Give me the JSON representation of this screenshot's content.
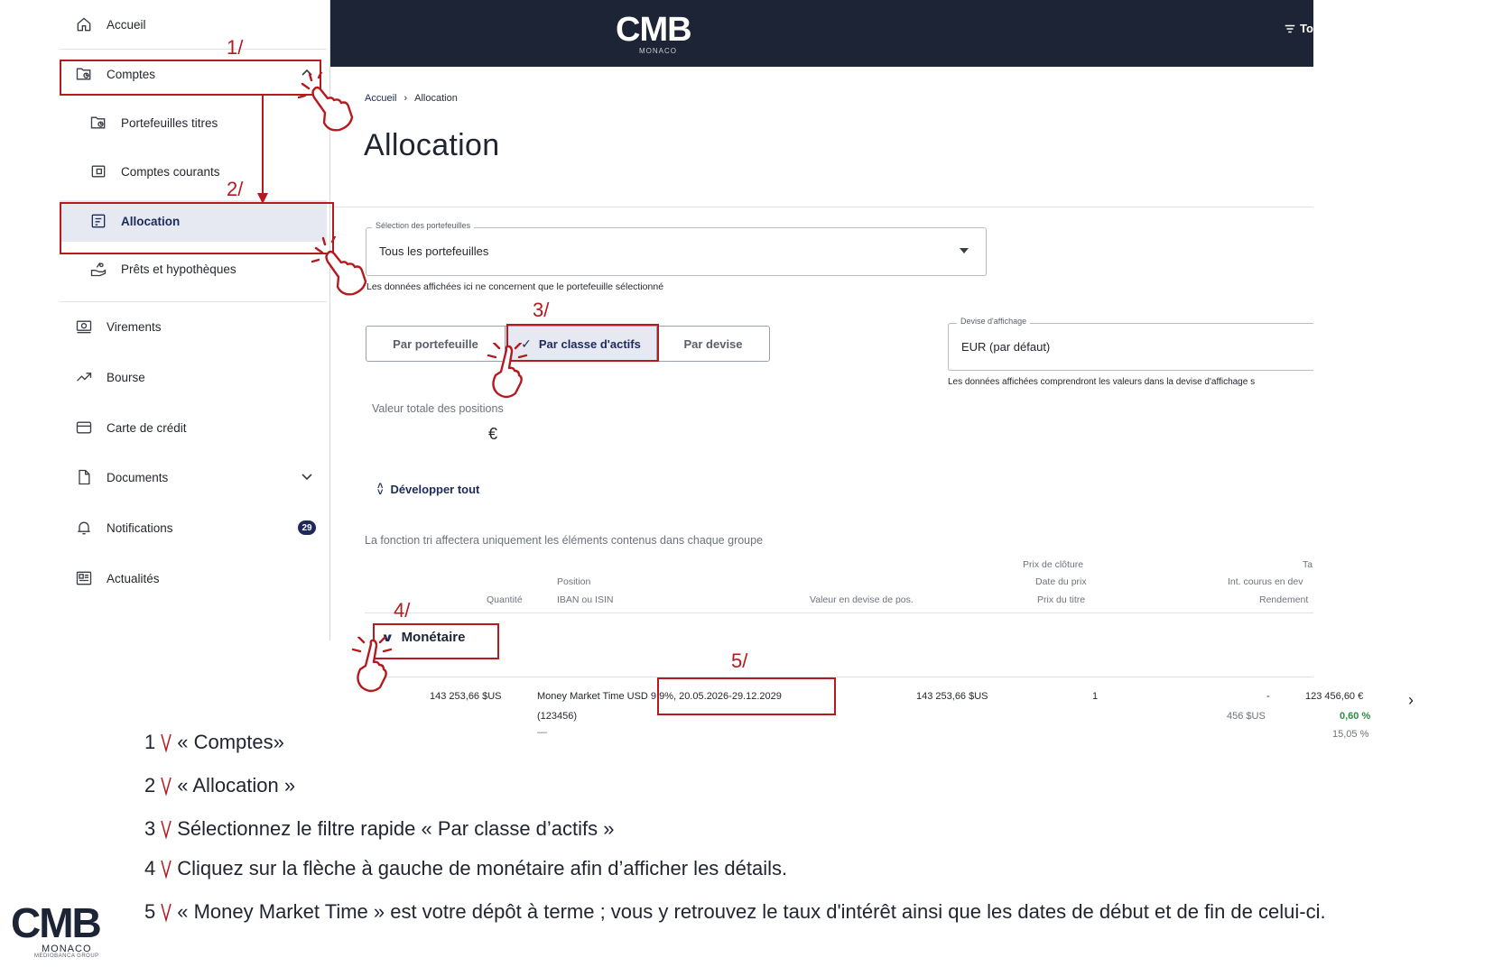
{
  "sidebar": {
    "items": [
      {
        "label": "Accueil",
        "icon": "home-icon"
      },
      {
        "label": "Comptes",
        "icon": "wallet-chart-icon"
      },
      {
        "label": "Portefeuilles titres",
        "icon": "portfolio-icon"
      },
      {
        "label": "Comptes courants",
        "icon": "wallet-icon"
      },
      {
        "label": "Allocation",
        "icon": "allocation-icon"
      },
      {
        "label": "Prêts et hypothèques",
        "icon": "loan-hand-icon"
      },
      {
        "label": "Virements",
        "icon": "transfer-icon"
      },
      {
        "label": "Bourse",
        "icon": "trend-up-icon"
      },
      {
        "label": "Carte de crédit",
        "icon": "credit-card-icon"
      },
      {
        "label": "Documents",
        "icon": "document-icon"
      },
      {
        "label": "Notifications",
        "icon": "bell-icon",
        "badge": "29"
      },
      {
        "label": "Actualités",
        "icon": "news-icon"
      }
    ]
  },
  "header": {
    "logo": "CMB",
    "logo_sub": "MONACO",
    "filter_label": "To"
  },
  "breadcrumb": {
    "home": "Accueil",
    "current": "Allocation"
  },
  "page": {
    "title": "Allocation"
  },
  "portfolio_select": {
    "legend": "Sélection des portefeuilles",
    "value": "Tous les portefeuilles",
    "help": "Les données affichées ici ne concernent que le portefeuille sélectionné"
  },
  "segmented": {
    "left": "Par portefeuille",
    "mid": "Par classe d'actifs",
    "right": "Par devise",
    "check": "✓"
  },
  "currency_select": {
    "legend": "Devise d'affichage",
    "value": "EUR (par défaut)",
    "help": "Les données affichées comprendront les valeurs dans la devise d'affichage s"
  },
  "total": {
    "label": "Valeur totale des positions",
    "value": "€"
  },
  "expand_all": "Développer tout",
  "sort_note": "La fonction tri affectera uniquement les éléments contenus dans chaque groupe",
  "table_headers": {
    "quantity": "Quantité",
    "position": "Position",
    "iban": "IBAN ou ISIN",
    "value_pos": "Valeur en devise de pos.",
    "close_price": "Prix de clôture",
    "price_date": "Date du prix",
    "title_price": "Prix du titre",
    "ta": "Ta",
    "accrued": "Int. courus en dev",
    "yield": "Rendement"
  },
  "group": {
    "label": "Monétaire"
  },
  "row": {
    "quantity": "143 253,66 $US",
    "position": "Money Market Time USD 9.9%, 20.05.2026-29.12.2029",
    "isin": "(123456)",
    "dash_small": "—",
    "value_pos": "143 253,66 $US",
    "close_price": "1",
    "dash": "-",
    "accrued": "456 $US",
    "amount": "123 456,60 €",
    "pct1": "0,60 %",
    "pct2": "15,05 %"
  },
  "annotations": {
    "n1": "1/",
    "n2": "2/",
    "n3": "3/",
    "n4": "4/",
    "n5": "5/",
    "color": "#b51a1f"
  },
  "instructions": [
    {
      "num": "1",
      "text": "« Comptes»"
    },
    {
      "num": "2",
      "text": "« Allocation »"
    },
    {
      "num": "3",
      "text": " Sélectionnez le filtre rapide « Par classe d’actifs »"
    },
    {
      "num": "4",
      "text": "Cliquez sur la flèche à gauche de monétaire afin d’afficher les détails."
    },
    {
      "num": "5",
      "text": "« Money Market Time » est votre dépôt à terme ; vous y retrouvez le taux d'intérêt ainsi que les dates de début et de fin de celui-ci."
    }
  ],
  "footer_logo": {
    "cmb": "CMB",
    "monaco": "MONACO",
    "group": "MEDIOBANCA GROUP"
  },
  "colors": {
    "navy": "#1d2436",
    "accent": "#1d2a5a",
    "active_bg": "#e6e9f1",
    "annotation_red": "#b51a1f",
    "green": "#2e8a45"
  }
}
